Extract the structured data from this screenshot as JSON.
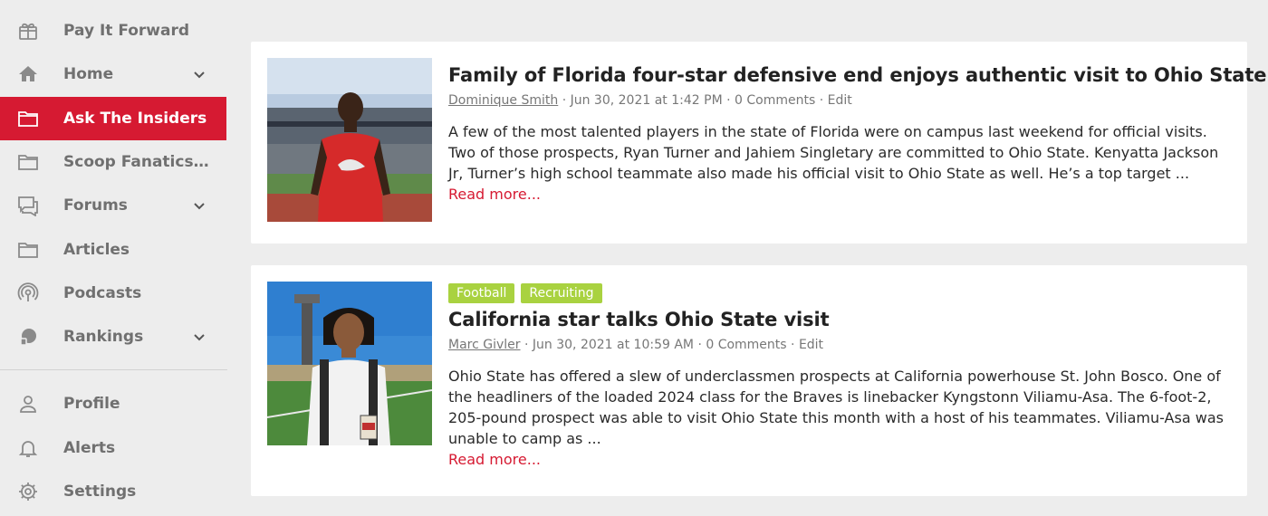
{
  "sidebar": {
    "items": [
      {
        "label": "Pay It Forward",
        "icon": "gift-icon",
        "has_chevron": false,
        "active": false
      },
      {
        "label": "Home",
        "icon": "home-icon",
        "has_chevron": true,
        "active": false
      },
      {
        "label": "Ask The Insiders",
        "icon": "folder-icon",
        "has_chevron": false,
        "active": true
      },
      {
        "label": "Scoop Fanatics St...",
        "icon": "folder-icon",
        "has_chevron": false,
        "active": false
      },
      {
        "label": "Forums",
        "icon": "chat-icon",
        "has_chevron": true,
        "active": false
      },
      {
        "label": "Articles",
        "icon": "folder-icon",
        "has_chevron": false,
        "active": false
      },
      {
        "label": "Podcasts",
        "icon": "podcast-icon",
        "has_chevron": false,
        "active": false
      },
      {
        "label": "Rankings",
        "icon": "rankings-icon",
        "has_chevron": true,
        "active": false
      }
    ],
    "bottom_items": [
      {
        "label": "Profile",
        "icon": "user-icon"
      },
      {
        "label": "Alerts",
        "icon": "bell-icon"
      },
      {
        "label": "Settings",
        "icon": "gear-icon"
      }
    ],
    "accent_color": "#d61a32"
  },
  "articles": [
    {
      "tags": [],
      "title": "Family of Florida four-star defensive end enjoys authentic visit to Ohio State",
      "author": "Dominique Smith",
      "meta": " · Jun 30, 2021 at 1:42 PM · 0 Comments · ",
      "edit": "Edit",
      "excerpt": "A few of the most talented players in the state of Florida were on campus last weekend for official visits. Two of those prospects, Ryan Turner and Jahiem Singletary are committed to Ohio State.  Kenyatta Jackson Jr, Turner’s high school teammate also made his official visit to Ohio State as well. He’s a top target ...",
      "read_more": "Read more..."
    },
    {
      "tags": [
        "Football",
        "Recruiting"
      ],
      "title": "California star talks Ohio State visit",
      "author": "Marc Givler",
      "meta": " · Jun 30, 2021 at 10:59 AM · 0 Comments · ",
      "edit": "Edit",
      "excerpt": "Ohio State has offered a slew of underclassmen prospects at California powerhouse St. John Bosco. One of the headliners of the loaded 2024 class for the Braves is linebacker Kyngstonn Viliamu-Asa. The 6-foot-2, 205-pound prospect was able to visit Ohio State this month with a host of his teammates. Viliamu-Asa was unable to camp as ...",
      "read_more": "Read more..."
    }
  ]
}
